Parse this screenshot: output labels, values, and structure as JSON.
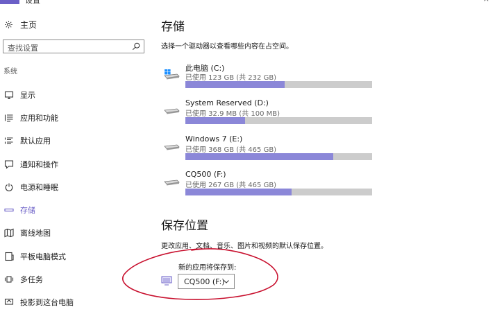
{
  "window": {
    "title": "设置"
  },
  "sidebar": {
    "home_label": "主页",
    "search_placeholder": "查找设置",
    "section_label": "系统",
    "items": [
      {
        "label": "显示",
        "icon": "monitor-icon"
      },
      {
        "label": "应用和功能",
        "icon": "list-icon"
      },
      {
        "label": "默认应用",
        "icon": "default-apps-icon"
      },
      {
        "label": "通知和操作",
        "icon": "notification-icon"
      },
      {
        "label": "电源和睡眠",
        "icon": "power-icon"
      },
      {
        "label": "存储",
        "icon": "storage-icon"
      },
      {
        "label": "离线地图",
        "icon": "map-icon"
      },
      {
        "label": "平板电脑模式",
        "icon": "tablet-icon"
      },
      {
        "label": "多任务",
        "icon": "multitask-icon"
      },
      {
        "label": "投影到这台电脑",
        "icon": "project-icon"
      }
    ],
    "active_index": 5
  },
  "storage": {
    "title": "存储",
    "description": "选择一个驱动器以查看哪些内容在占空间。",
    "drives": [
      {
        "name": "此电脑 (C:)",
        "usage": "已使用 123 GB (共 232 GB)",
        "used_fraction": 0.53,
        "icon": "windows-drive-icon"
      },
      {
        "name": "System Reserved (D:)",
        "usage": "已使用 32.9 MB (共 100 MB)",
        "used_fraction": 0.32,
        "icon": "drive-icon"
      },
      {
        "name": "Windows 7 (E:)",
        "usage": "已使用 368 GB (共 465 GB)",
        "used_fraction": 0.79,
        "icon": "drive-icon"
      },
      {
        "name": "CQ500 (F:)",
        "usage": "已使用 267 GB (共 465 GB)",
        "used_fraction": 0.57,
        "icon": "drive-icon"
      }
    ]
  },
  "save_locations": {
    "title": "保存位置",
    "description": "更改应用、文档、音乐、图片和视频的默认保存位置。",
    "new_apps_label": "新的应用将保存到:",
    "new_apps_value": "CQ500 (F:)"
  },
  "colors": {
    "accent": "#6b5fc7",
    "bar_fill": "#8b87d8",
    "bar_track": "#cccccc",
    "annotation": "#c8102e"
  }
}
